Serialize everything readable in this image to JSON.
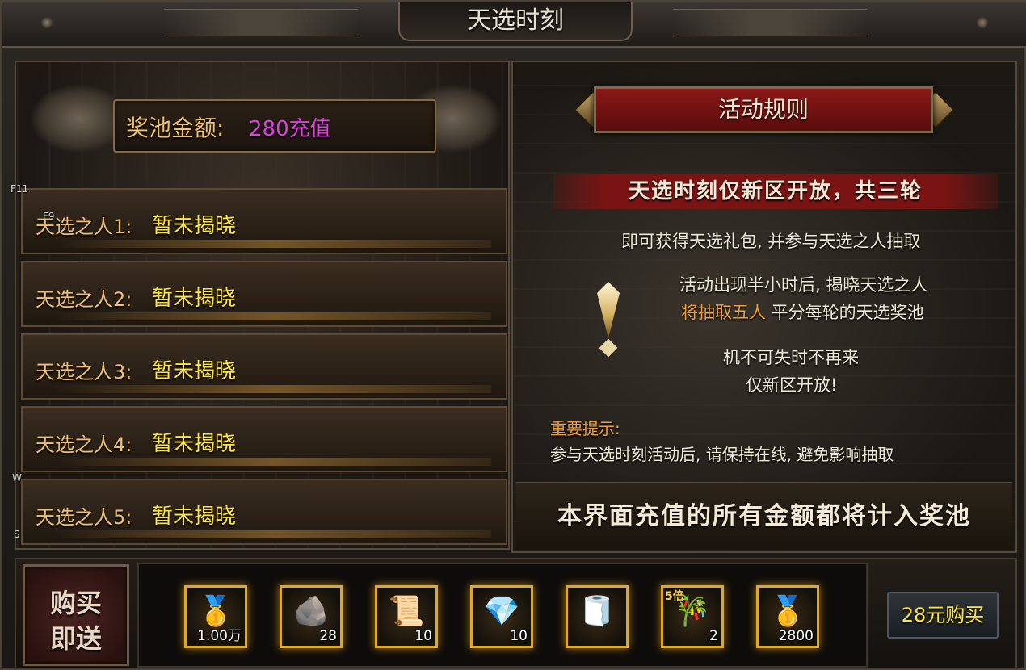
{
  "window": {
    "title": "天选时刻"
  },
  "hotkeys": {
    "f11": "F11",
    "f9": "F9",
    "w": "W",
    "s": "S"
  },
  "pool": {
    "label": "奖池金额:",
    "value": "280充值"
  },
  "winners": [
    {
      "label": "天选之人1:",
      "status": "暂未揭晓"
    },
    {
      "label": "天选之人2:",
      "status": "暂未揭晓"
    },
    {
      "label": "天选之人3:",
      "status": "暂未揭晓"
    },
    {
      "label": "天选之人4:",
      "status": "暂未揭晓"
    },
    {
      "label": "天选之人5:",
      "status": "暂未揭晓"
    }
  ],
  "rules": {
    "header": "活动规则",
    "banner": "天选时刻仅新区开放，共三轮",
    "line1": "即可获得天选礼包, 并参与天选之人抽取",
    "line2": "活动出现半小时后, 揭晓天选之人",
    "line3_highlight": "将抽取五人",
    "line3_rest": " 平分每轮的天选奖池",
    "line4": "机不可失时不再来",
    "line5": "仅新区开放!",
    "important_title": "重要提示:",
    "important_text": "参与天选时刻活动后, 请保持在线, 避免影响抽取",
    "bottom_banner": "本界面充值的所有金额都将计入奖池"
  },
  "purchase": {
    "badge_line1": "购买",
    "badge_line2": "即送",
    "button_label": "28元购买"
  },
  "items": [
    {
      "icon": "gold-ingot-icon",
      "glyph": "🥇",
      "count": "1.00万",
      "tag": ""
    },
    {
      "icon": "ore-icon",
      "glyph": "🪨",
      "count": "28",
      "tag": ""
    },
    {
      "icon": "scroll-icon",
      "glyph": "📜",
      "count": "10",
      "tag": ""
    },
    {
      "icon": "crystal-icon",
      "glyph": "💎",
      "count": "10",
      "tag": ""
    },
    {
      "icon": "rolled-scroll-icon",
      "glyph": "🧻",
      "count": "",
      "tag": ""
    },
    {
      "icon": "flute-icon",
      "glyph": "🎋",
      "count": "2",
      "tag": "5倍"
    },
    {
      "icon": "gold-ingot-icon",
      "glyph": "🥇",
      "count": "2800",
      "tag": ""
    }
  ]
}
